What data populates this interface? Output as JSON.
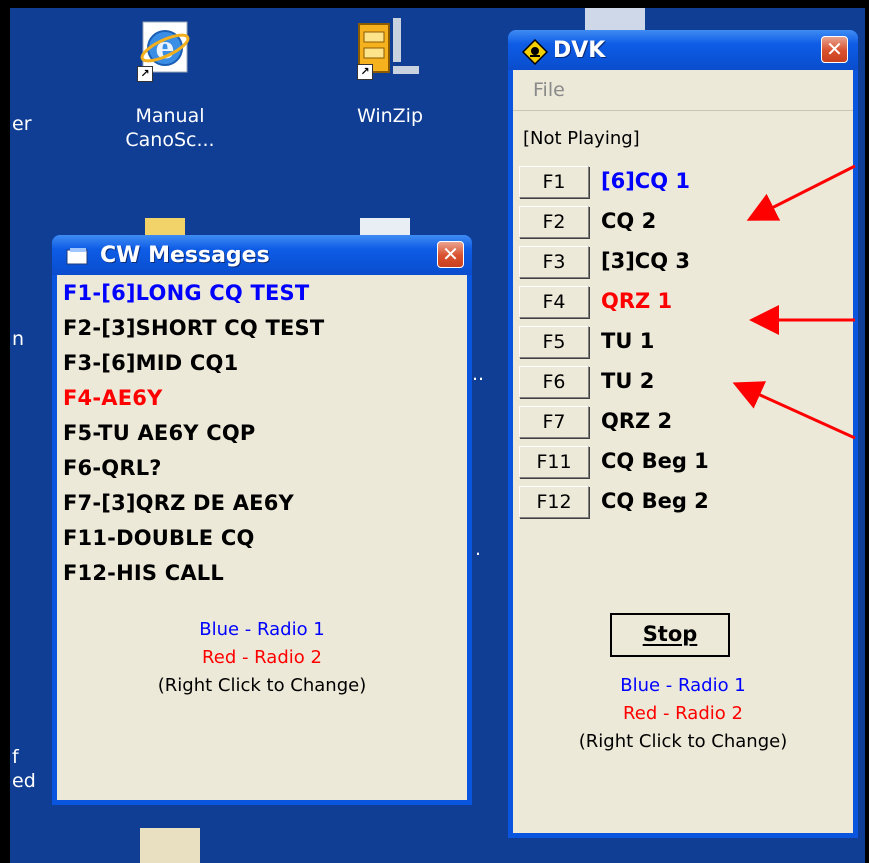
{
  "desktop": {
    "icons": [
      {
        "label_line1": "Manual",
        "label_line2": "CanoSc...",
        "icon": "internet-explorer-icon"
      },
      {
        "label_line1": "WinZip",
        "label_line2": "",
        "icon": "winzip-icon"
      }
    ],
    "partial_labels": [
      "er",
      "n",
      "f",
      "ed",
      "..",
      "."
    ]
  },
  "cw_window": {
    "title": "CW Messages",
    "close_glyph": "✕",
    "messages": [
      {
        "text": "F1-[6]LONG CQ TEST",
        "color": "#0000ff"
      },
      {
        "text": "F2-[3]SHORT CQ TEST",
        "color": "#000000"
      },
      {
        "text": "F3-[6]MID CQ1",
        "color": "#000000"
      },
      {
        "text": "F4-AE6Y",
        "color": "#ff0000"
      },
      {
        "text": "F5-TU AE6Y CQP",
        "color": "#000000"
      },
      {
        "text": "F6-QRL?",
        "color": "#000000"
      },
      {
        "text": "F7-[3]QRZ DE AE6Y",
        "color": "#000000"
      },
      {
        "text": "F11-DOUBLE CQ",
        "color": "#000000"
      },
      {
        "text": "F12-HIS CALL",
        "color": "#000000"
      }
    ],
    "legend_blue": "Blue - Radio 1",
    "legend_red": "Red - Radio 2",
    "legend_hint": "(Right Click to Change)"
  },
  "dvk_window": {
    "title": "DVK",
    "close_glyph": "✕",
    "menu_file": "File",
    "status": "[Not Playing]",
    "rows": [
      {
        "key": "F1",
        "label": "[6]CQ 1",
        "color": "#0000ff"
      },
      {
        "key": "F2",
        "label": "CQ 2",
        "color": "#000000"
      },
      {
        "key": "F3",
        "label": "[3]CQ 3",
        "color": "#000000"
      },
      {
        "key": "F4",
        "label": "QRZ 1",
        "color": "#ff0000"
      },
      {
        "key": "F5",
        "label": "TU 1",
        "color": "#000000"
      },
      {
        "key": "F6",
        "label": "TU 2",
        "color": "#000000"
      },
      {
        "key": "F7",
        "label": "QRZ 2",
        "color": "#000000"
      },
      {
        "key": "F11",
        "label": "CQ Beg 1",
        "color": "#000000"
      },
      {
        "key": "F12",
        "label": "CQ Beg 2",
        "color": "#000000"
      }
    ],
    "stop_label": "Stop",
    "legend_blue": "Blue - Radio 1",
    "legend_red": "Red - Radio 2",
    "legend_hint": "(Right Click to Change)"
  },
  "colors": {
    "desktop": "#0f3e94",
    "annotation_arrow": "#ff0000",
    "radio1": "#0000ff",
    "radio2": "#ff0000"
  }
}
